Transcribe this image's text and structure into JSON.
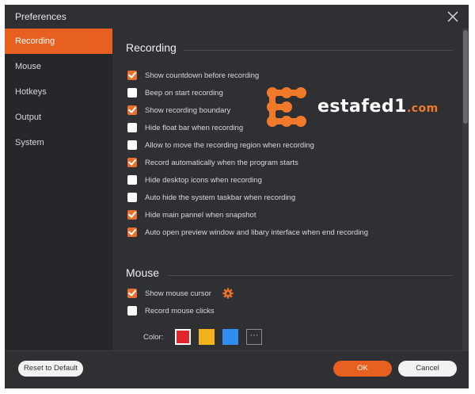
{
  "window": {
    "title": "Preferences"
  },
  "sidebar": {
    "items": [
      {
        "label": "Recording",
        "active": true
      },
      {
        "label": "Mouse",
        "active": false
      },
      {
        "label": "Hotkeys",
        "active": false
      },
      {
        "label": "Output",
        "active": false
      },
      {
        "label": "System",
        "active": false
      }
    ]
  },
  "recording": {
    "title": "Recording",
    "options": [
      {
        "label": "Show countdown before recording",
        "checked": true
      },
      {
        "label": "Beep on start recording",
        "checked": false
      },
      {
        "label": "Show recording boundary",
        "checked": true
      },
      {
        "label": "Hide float bar when recording",
        "checked": false
      },
      {
        "label": "Allow to move the recording region when recording",
        "checked": false
      },
      {
        "label": "Record automatically when the program starts",
        "checked": true
      },
      {
        "label": "Hide desktop icons when recording",
        "checked": false
      },
      {
        "label": "Auto hide the system taskbar when recording",
        "checked": false
      },
      {
        "label": "Hide main pannel when snapshot",
        "checked": true
      },
      {
        "label": "Auto open preview window and libary interface when end recording",
        "checked": true
      }
    ]
  },
  "mouse": {
    "title": "Mouse",
    "options": [
      {
        "label": "Show mouse cursor",
        "checked": true
      },
      {
        "label": "Record mouse clicks",
        "checked": false
      }
    ],
    "color_label": "Color:",
    "colors": [
      "#e0262b",
      "#f4b21a",
      "#2f8ef0"
    ],
    "selected_color": "#e0262b",
    "more_label": "···"
  },
  "watermark": {
    "name": "estafed1",
    "suffix": ".com"
  },
  "footer": {
    "reset_label": "Reset to Default",
    "ok_label": "OK",
    "cancel_label": "Cancel"
  },
  "colors": {
    "accent": "#e8601f",
    "background": "#2f3033",
    "sidebar": "#26272a"
  }
}
